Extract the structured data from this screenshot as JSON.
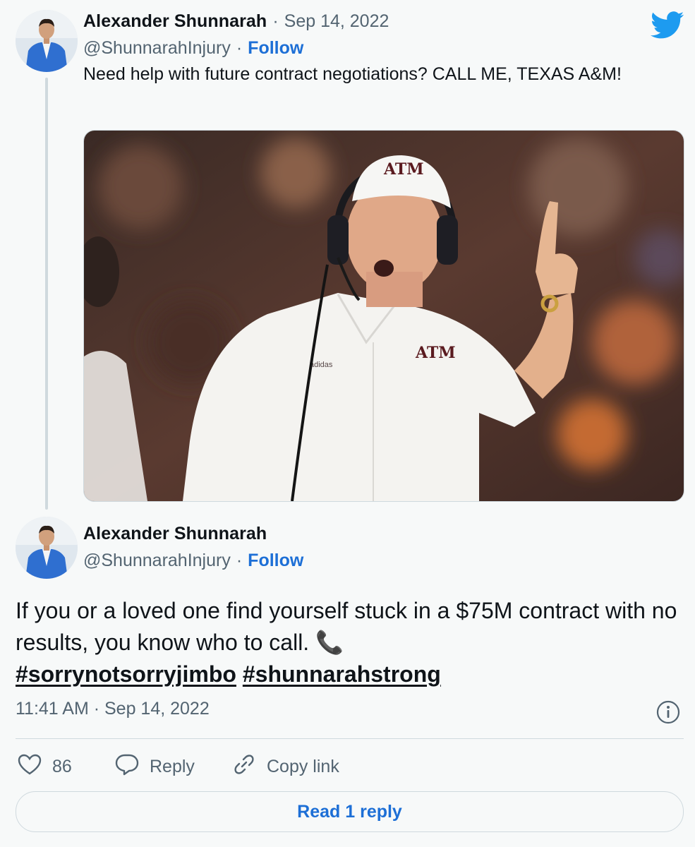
{
  "tweet": {
    "author_name": "Alexander Shunnarah",
    "date_separator": "·",
    "date": "Sep 14, 2022",
    "handle": "@ShunnarahInjury",
    "handle_separator": "·",
    "follow_label": "Follow",
    "text": "Need help with future contract negotiations? CALL ME, TEXAS A&M!",
    "cap_logo_text": "ATM",
    "shirt_logo_text": "ATM",
    "brand_text": "adidas"
  },
  "quoted_tweet": {
    "author_name": "Alexander Shunnarah",
    "handle": "@ShunnarahInjury",
    "handle_separator": "·",
    "follow_label": "Follow",
    "text": "If you or a loved one find yourself stuck in a $75M contract with no results, you know who to call. 📞",
    "hashtags": [
      "#sorrynotsorryjimbo",
      "#shunnarahstrong"
    ],
    "timestamp": "11:41 AM · Sep 14, 2022"
  },
  "actions": {
    "like_count": "86",
    "reply_label": "Reply",
    "copy_link_label": "Copy link",
    "read_reply_label": "Read 1 reply"
  },
  "icons": {
    "brand": "twitter-bird-icon",
    "info": "info-icon",
    "like": "heart-icon",
    "reply": "speech-bubble-icon",
    "copy": "link-icon",
    "phone": "telephone-receiver-emoji"
  },
  "colors": {
    "accent": "#1d6fd6",
    "twitter_blue": "#1d9bf0",
    "muted": "#536471",
    "border": "#cfd9de",
    "background": "#f7f9f9"
  }
}
